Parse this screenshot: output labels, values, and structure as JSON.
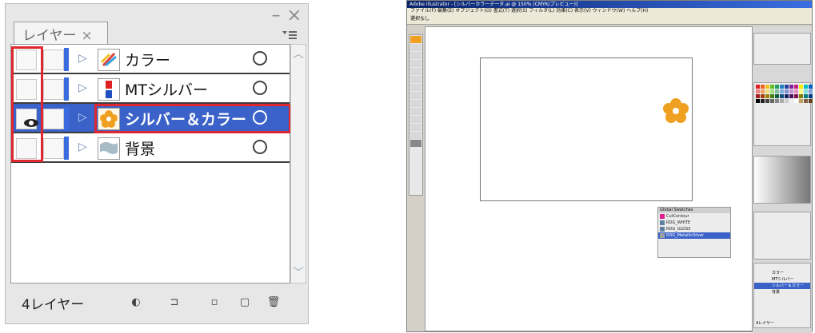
{
  "layers_panel": {
    "tab_label": "レイヤー",
    "tab_close": "×",
    "window_minimize": "–",
    "window_close": "×",
    "menu_icon": "menu-icon",
    "layers": [
      {
        "name": "カラー",
        "visible": false,
        "selected": false
      },
      {
        "name": "MTシルバー",
        "visible": false,
        "selected": false
      },
      {
        "name": "シルバー＆カラー",
        "visible": true,
        "selected": true
      },
      {
        "name": "背景",
        "visible": false,
        "selected": false
      }
    ],
    "layer_count": "4レイヤー",
    "colors": {
      "selected": "#3a62c8",
      "highlight": "#e0262e",
      "layer_color": "#3a6be0"
    }
  },
  "illustrator": {
    "title": "Adobe Illustrator - [シルバーカラーデータ.ai @ 150% (CMYK/プレビュー)]",
    "menu": "ファイル(F)  編集(E)  オブジェクト(O)  書式(T)  選択(S)  フィルタ(L)  効果(C)  表示(V)  ウィンドウ(W)  ヘルプ(H)",
    "control": "選択なし",
    "swatch_panel_title": "Global Swatches",
    "swatches": [
      "CutContour",
      "RDG_WHITE",
      "RDG_GLOSS",
      "RDG_MetallicSilver"
    ],
    "mini_layers": [
      "カラー",
      "MTシルバー",
      "シルバー＆カラー",
      "背景"
    ],
    "mini_count": "4レイヤー",
    "flower_color": "#f0a020"
  }
}
